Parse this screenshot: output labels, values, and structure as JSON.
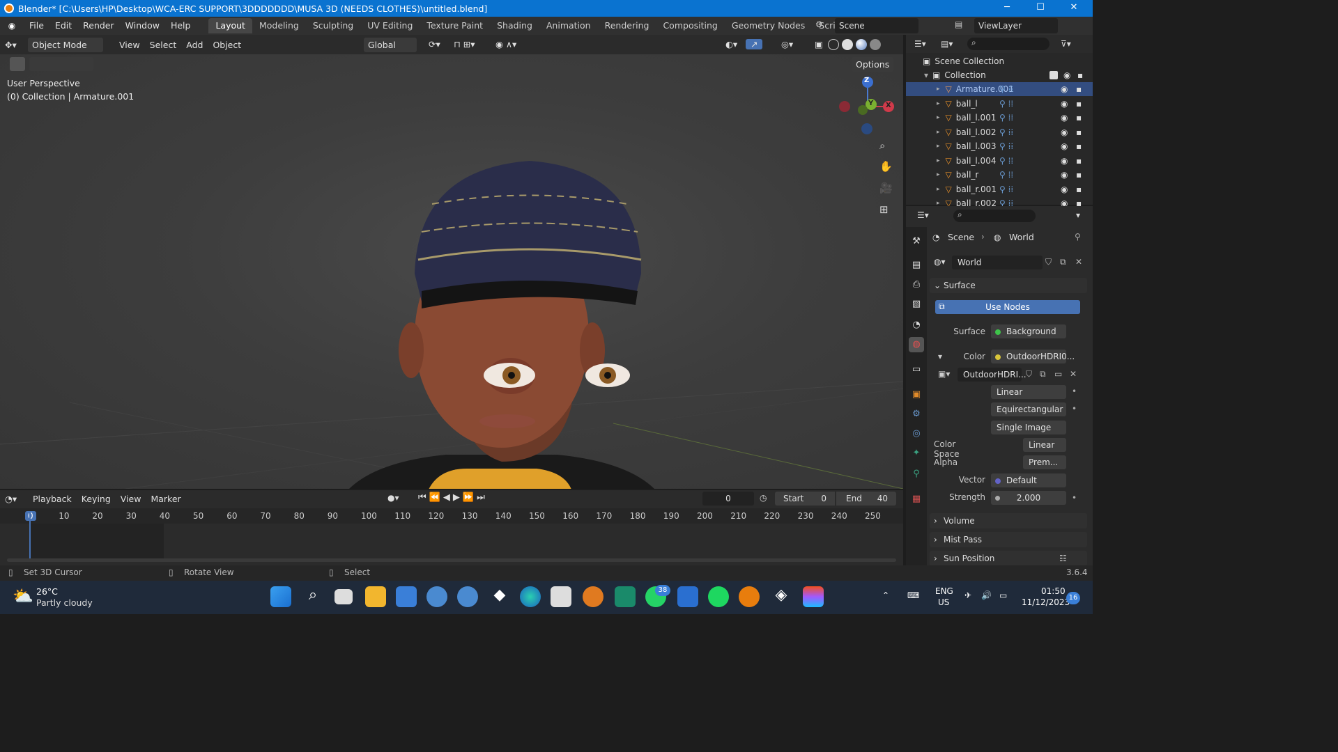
{
  "window": {
    "title": "Blender* [C:\\Users\\HP\\Desktop\\WCA-ERC SUPPORT\\3DDDDDDD\\MUSA 3D (NEEDS CLOTHES)\\untitled.blend]",
    "minimize": "─",
    "maximize": "☐",
    "close": "✕"
  },
  "menu": {
    "items": [
      "File",
      "Edit",
      "Render",
      "Window",
      "Help"
    ],
    "workspaces": [
      "Layout",
      "Modeling",
      "Sculpting",
      "UV Editing",
      "Texture Paint",
      "Shading",
      "Animation",
      "Rendering",
      "Compositing",
      "Geometry Nodes",
      "Scripting"
    ],
    "active_workspace": "Layout",
    "add": "+",
    "scene": "Scene",
    "viewlayer": "ViewLayer"
  },
  "header": {
    "mode": "Object Mode",
    "view": "View",
    "select": "Select",
    "add": "Add",
    "object": "Object",
    "orientation": "Global",
    "options": "Options"
  },
  "viewport": {
    "perspective": "User Perspective",
    "collection_info": "(0) Collection | Armature.001",
    "gizmo": {
      "z": "Z",
      "y": "Y",
      "x": "X"
    }
  },
  "outliner": {
    "root": "Scene Collection",
    "collection": "Collection",
    "items": [
      "Armature.001",
      "ball_l",
      "ball_l.001",
      "ball_l.002",
      "ball_l.003",
      "ball_l.004",
      "ball_r",
      "ball_r.001",
      "ball_r.002"
    ]
  },
  "properties": {
    "breadcrumb_scene": "Scene",
    "breadcrumb_world": "World",
    "world_name": "World",
    "surface_panel": "Surface",
    "use_nodes": "Use Nodes",
    "surface_label": "Surface",
    "surface_value": "Background",
    "color_label": "Color",
    "color_value": "OutdoorHDRI0...",
    "image_name": "OutdoorHDRI...",
    "interp": "Linear",
    "projection": "Equirectangular",
    "source": "Single Image",
    "color_space_label": "Color Space",
    "color_space_value": "Linear",
    "alpha_label": "Alpha",
    "alpha_value": "Prem...",
    "vector_label": "Vector",
    "vector_value": "Default",
    "strength_label": "Strength",
    "strength_value": "2.000",
    "volume": "Volume",
    "mist": "Mist Pass",
    "sun": "Sun Position"
  },
  "timeline": {
    "playback": "Playback",
    "keying": "Keying",
    "view": "View",
    "marker": "Marker",
    "current_frame": "0",
    "start_label": "Start",
    "start_value": "0",
    "end_label": "End",
    "end_value": "40",
    "ruler": [
      "0",
      "10",
      "20",
      "30",
      "40",
      "50",
      "60",
      "70",
      "80",
      "90",
      "100",
      "110",
      "120",
      "130",
      "140",
      "150",
      "160",
      "170",
      "180",
      "190",
      "200",
      "210",
      "220",
      "230",
      "240",
      "250"
    ]
  },
  "status": {
    "cursor": "Set 3D Cursor",
    "rotate": "Rotate View",
    "select": "Select",
    "version": "3.6.4"
  },
  "taskbar": {
    "temp": "26°C",
    "weather": "Partly cloudy",
    "lang1": "ENG",
    "lang2": "US",
    "time": "01:50",
    "date": "11/12/2023",
    "whatsapp_badge": "38",
    "notif": "16"
  }
}
